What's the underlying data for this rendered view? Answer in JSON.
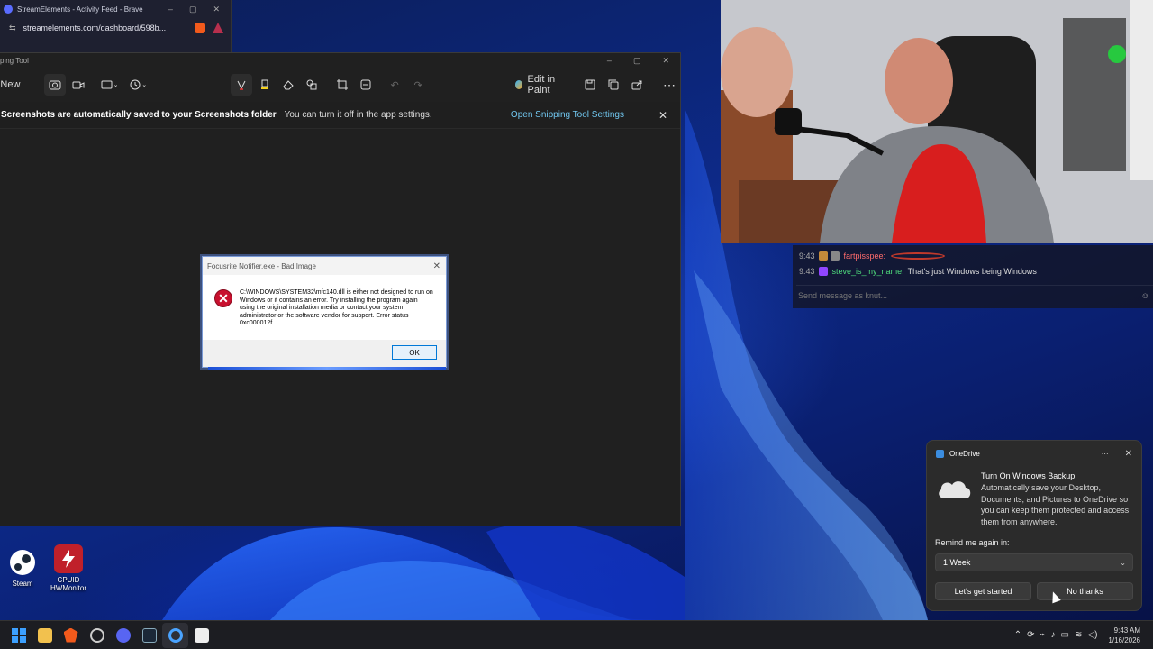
{
  "brave": {
    "tab_title": "StreamElements - Activity Feed - Brave",
    "url": "streamelements.com/dashboard/598b..."
  },
  "snipping_tool": {
    "title": "ping Tool",
    "new_label": "New",
    "edit_in_paint": "Edit in Paint",
    "banner_bold": "Screenshots are automatically saved to your Screenshots folder",
    "banner_text": "You can turn it off in the app settings.",
    "banner_link": "Open Snipping Tool Settings"
  },
  "error_dialog": {
    "title": "Focusrite Notifier.exe - Bad Image",
    "message": "C:\\WINDOWS\\SYSTEM32\\mfc140.dll is either not designed to run on Windows or it contains an error. Try installing the program again using the original installation media or contact your system administrator or the software vendor for support. Error status 0xc000012f.",
    "ok_label": "OK"
  },
  "chat": {
    "messages": [
      {
        "time": "9:43",
        "user": "fartpisspee:",
        "text": ""
      },
      {
        "time": "9:43",
        "user": "steve_is_my_name:",
        "text": "That's just Windows being Windows"
      }
    ],
    "input_placeholder": "Send message as knut..."
  },
  "desktop_icons": [
    {
      "label": "Steam"
    },
    {
      "label": "CPUID HWMonitor"
    }
  ],
  "onedrive": {
    "app_name": "OneDrive",
    "title": "Turn On Windows Backup",
    "description": "Automatically save your Desktop, Documents, and Pictures to OneDrive so you can keep them protected and access them from anywhere.",
    "remind_label": "Remind me again in:",
    "remind_value": "1 Week",
    "primary_button": "Let's get started",
    "secondary_button": "No thanks"
  },
  "taskbar": {
    "time": "9:43 AM",
    "date": "1/16/2026"
  },
  "colors": {
    "link": "#71c7f0",
    "error_red": "#c8102e",
    "chat_user1": "#ff6c6c",
    "chat_user2": "#4fdc7c"
  }
}
